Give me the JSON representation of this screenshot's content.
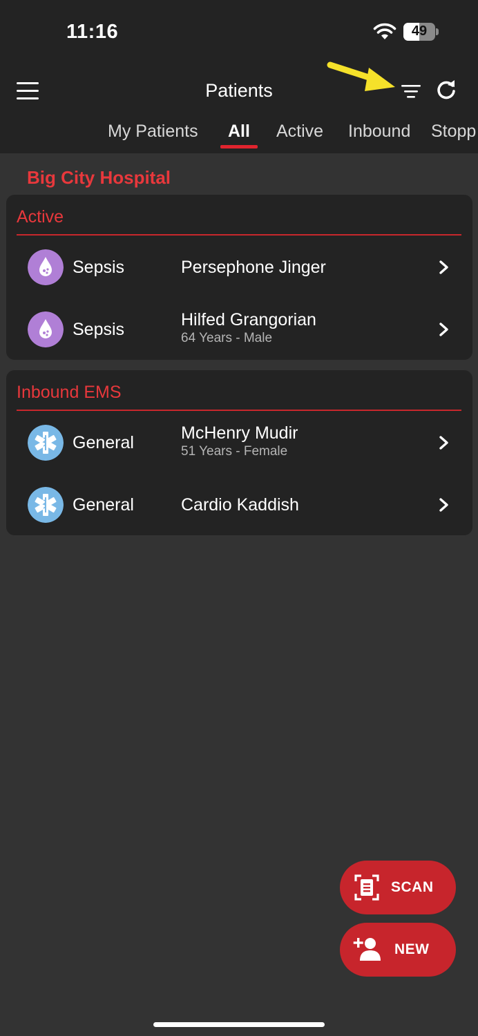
{
  "status_bar": {
    "time": "11:16",
    "battery_level": "49",
    "battery_fraction": 0.49
  },
  "header": {
    "title": "Patients"
  },
  "tabs": [
    {
      "label": "My Patients",
      "selected": false
    },
    {
      "label": "All",
      "selected": true
    },
    {
      "label": "Active",
      "selected": false
    },
    {
      "label": "Inbound",
      "selected": false
    },
    {
      "label": "Stopp",
      "selected": false
    }
  ],
  "hospital_name": "Big City Hospital",
  "groups": [
    {
      "title": "Active",
      "rows": [
        {
          "icon": "blood-drop-icon",
          "type": "Sepsis",
          "name": "Persephone Jinger",
          "details": ""
        },
        {
          "icon": "blood-drop-icon",
          "type": "Sepsis",
          "name": "Hilfed Grangorian",
          "details": "64 Years - Male"
        }
      ]
    },
    {
      "title": "Inbound EMS",
      "rows": [
        {
          "icon": "star-of-life-icon",
          "type": "General",
          "name": "McHenry Mudir",
          "details": "51 Years - Female"
        },
        {
          "icon": "star-of-life-icon",
          "type": "General",
          "name": "Cardio Kaddish",
          "details": ""
        }
      ]
    }
  ],
  "actions": {
    "scan_label": "SCAN",
    "new_label": "NEW"
  },
  "colors": {
    "accent_red": "#e8383c",
    "button_red": "#c7252c",
    "sepsis_purple": "#b07fd6",
    "general_blue": "#79b8e6",
    "annotation_arrow": "#f5e12a"
  }
}
